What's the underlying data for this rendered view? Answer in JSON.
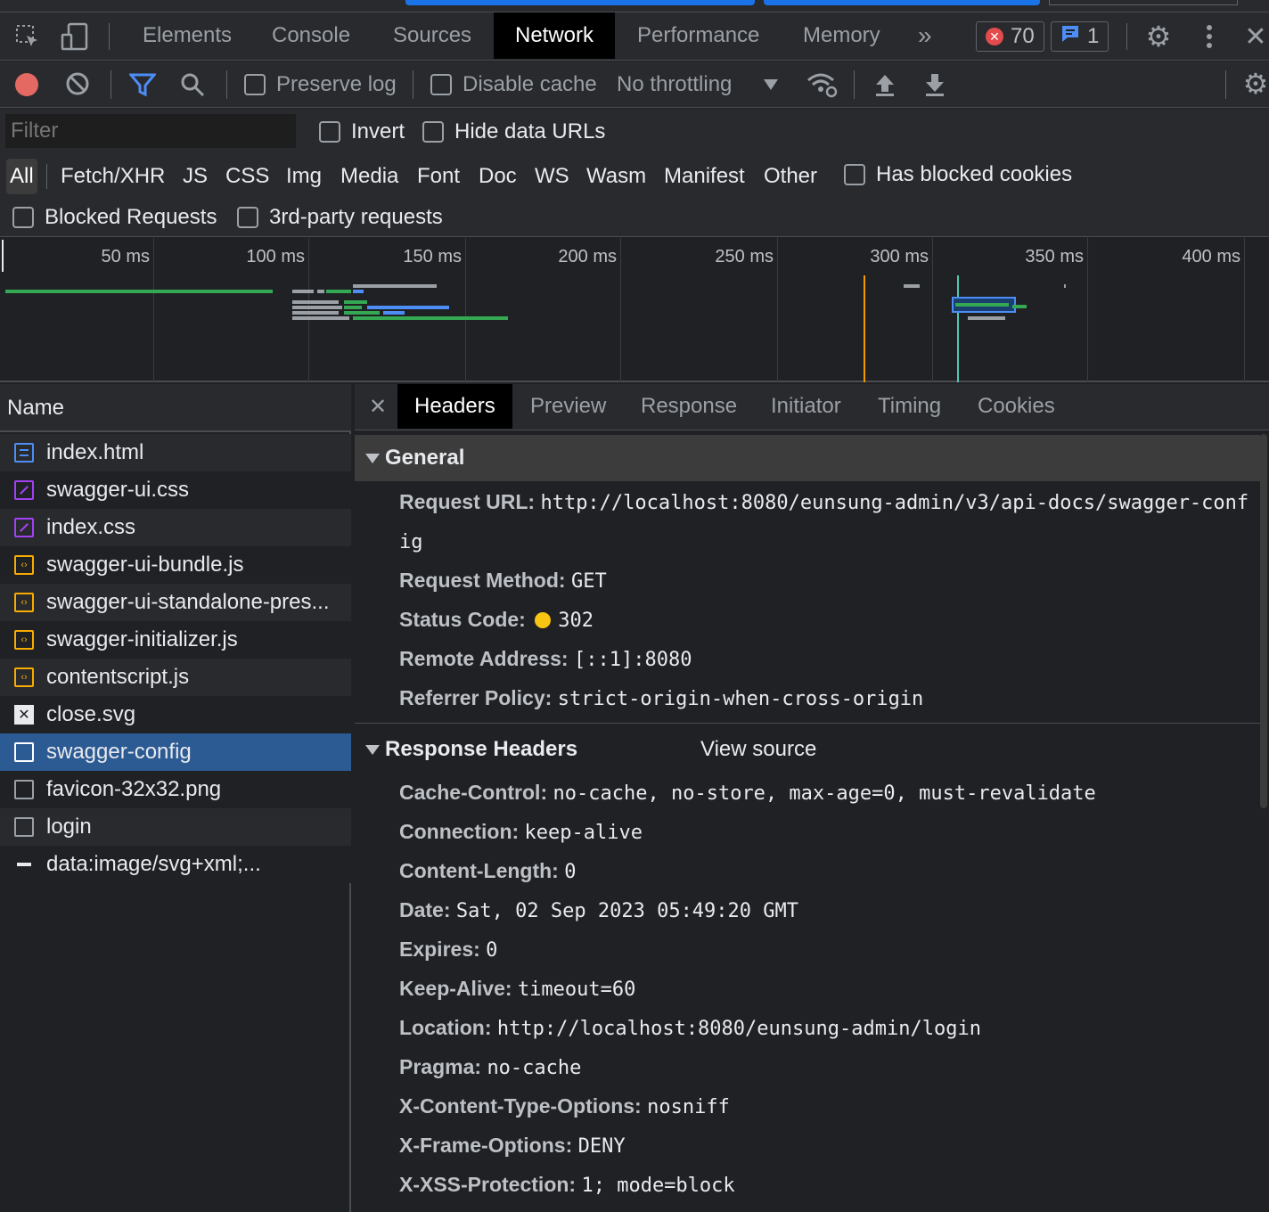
{
  "tabs": {
    "elements": "Elements",
    "console": "Console",
    "sources": "Sources",
    "network": "Network",
    "performance": "Performance",
    "memory": "Memory",
    "more": "»"
  },
  "badges": {
    "errors": "70",
    "messages": "1"
  },
  "toolbar": {
    "preserve_log": "Preserve log",
    "disable_cache": "Disable cache",
    "throttling": "No throttling"
  },
  "filter": {
    "placeholder": "Filter",
    "invert": "Invert",
    "hide_data_urls": "Hide data URLs",
    "has_blocked_cookies": "Has blocked cookies",
    "blocked_requests": "Blocked Requests",
    "third_party": "3rd-party requests",
    "types": [
      "All",
      "Fetch/XHR",
      "JS",
      "CSS",
      "Img",
      "Media",
      "Font",
      "Doc",
      "WS",
      "Wasm",
      "Manifest",
      "Other"
    ]
  },
  "timeline": {
    "ticks": [
      "50 ms",
      "100 ms",
      "150 ms",
      "200 ms",
      "250 ms",
      "300 ms",
      "350 ms",
      "400 ms"
    ]
  },
  "requests": {
    "header": "Name",
    "items": [
      {
        "name": "index.html",
        "icon": "html-file-icon",
        "color": "#4c8df6"
      },
      {
        "name": "swagger-ui.css",
        "icon": "css-file-icon",
        "color": "#a142f4"
      },
      {
        "name": "index.css",
        "icon": "css-file-icon",
        "color": "#a142f4"
      },
      {
        "name": "swagger-ui-bundle.js",
        "icon": "js-file-icon",
        "color": "#f9ab00"
      },
      {
        "name": "swagger-ui-standalone-pres...",
        "icon": "js-file-icon",
        "color": "#f9ab00"
      },
      {
        "name": "swagger-initializer.js",
        "icon": "js-file-icon",
        "color": "#f9ab00"
      },
      {
        "name": "contentscript.js",
        "icon": "js-file-icon",
        "color": "#f9ab00"
      },
      {
        "name": "close.svg",
        "icon": "image-file-icon",
        "color": "#e8eaed"
      },
      {
        "name": "swagger-config",
        "icon": "document-file-icon",
        "color": "#e8eaed"
      },
      {
        "name": "favicon-32x32.png",
        "icon": "image-file-icon",
        "color": "#9aa0a6"
      },
      {
        "name": "login",
        "icon": "document-file-icon",
        "color": "#9aa0a6"
      },
      {
        "name": "data:image/svg+xml;...",
        "icon": "data-url-icon",
        "color": "#e8eaed"
      }
    ]
  },
  "detail": {
    "tabs": [
      "Headers",
      "Preview",
      "Response",
      "Initiator",
      "Timing",
      "Cookies"
    ],
    "general_title": "General",
    "general": [
      {
        "k": "Request URL:",
        "v": "http://localhost:8080/eunsung-admin/v3/api-docs/swagger-conf"
      },
      {
        "k": "",
        "v": "ig"
      },
      {
        "k": "Request Method:",
        "v": "GET"
      },
      {
        "k": "Status Code:",
        "v": "302"
      },
      {
        "k": "Remote Address:",
        "v": "[::1]:8080"
      },
      {
        "k": "Referrer Policy:",
        "v": "strict-origin-when-cross-origin"
      }
    ],
    "response_title": "Response Headers",
    "view_source": "View source",
    "response": [
      {
        "k": "Cache-Control:",
        "v": "no-cache, no-store, max-age=0, must-revalidate"
      },
      {
        "k": "Connection:",
        "v": "keep-alive"
      },
      {
        "k": "Content-Length:",
        "v": "0"
      },
      {
        "k": "Date:",
        "v": "Sat, 02 Sep 2023 05:49:20 GMT"
      },
      {
        "k": "Expires:",
        "v": "0"
      },
      {
        "k": "Keep-Alive:",
        "v": "timeout=60"
      },
      {
        "k": "Location:",
        "v": "http://localhost:8080/eunsung-admin/login"
      },
      {
        "k": "Pragma:",
        "v": "no-cache"
      },
      {
        "k": "X-Content-Type-Options:",
        "v": "nosniff"
      },
      {
        "k": "X-Frame-Options:",
        "v": "DENY"
      },
      {
        "k": "X-XSS-Protection:",
        "v": "1; mode=block"
      }
    ]
  }
}
